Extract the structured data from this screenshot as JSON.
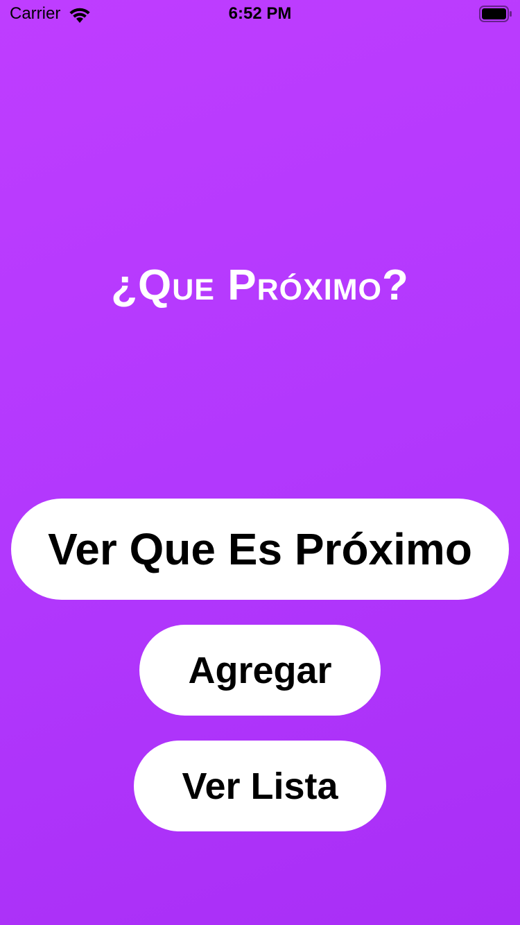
{
  "status_bar": {
    "carrier": "Carrier",
    "time": "6:52 PM",
    "wifi_icon": "wifi-icon",
    "battery_icon": "battery-icon"
  },
  "main": {
    "title": "¿Que Próximo?",
    "buttons": {
      "see_next": "Ver Que Es Próximo",
      "add": "Agregar",
      "see_list": "Ver Lista"
    }
  },
  "colors": {
    "background_top": "#bf3dff",
    "background_bottom": "#a92ef6",
    "button_bg": "#ffffff",
    "button_text": "#000000",
    "title_text": "#ffffff"
  }
}
